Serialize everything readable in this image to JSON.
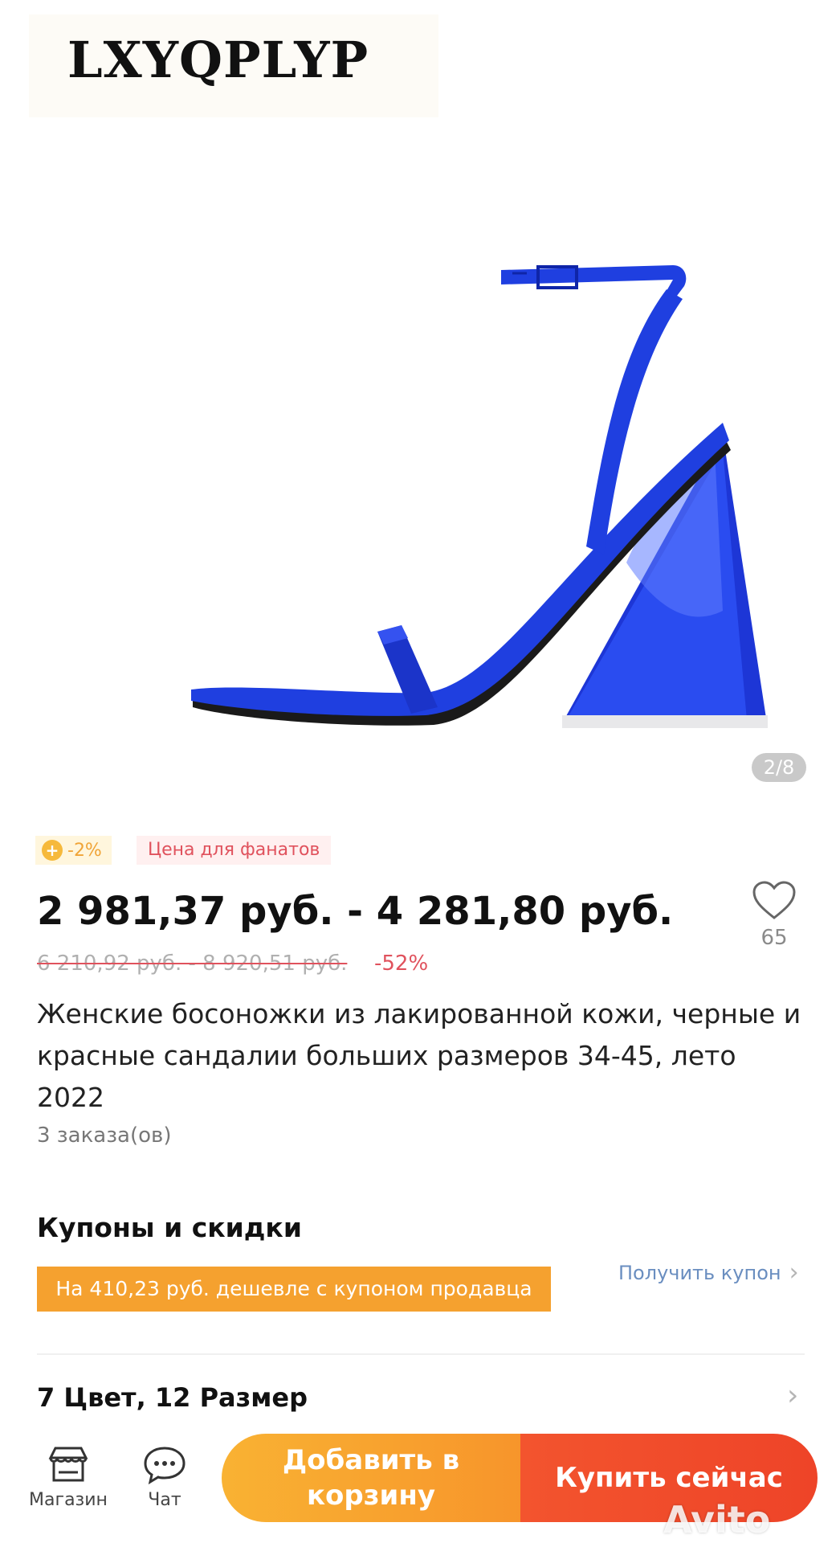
{
  "gallery": {
    "brand": "LXYQPLYP",
    "image_counter": "2/8",
    "colors": {
      "shoe": "#1f3fe0"
    }
  },
  "tags": {
    "coin": "-2%",
    "fan_price": "Цена для фанатов"
  },
  "price": {
    "current": "2 981,37 руб. - 4 281,80 руб.",
    "old": "6 210,92 руб. - 8 920,51 руб.",
    "discount": "-52%"
  },
  "wishlist": {
    "count": "65"
  },
  "product": {
    "title": "Женские босоножки из лакированной кожи, черные и красные сандалии больших размеров 34-45, лето 2022",
    "orders": "3 заказа(ов)"
  },
  "coupons": {
    "section_title": "Купоны и скидки",
    "banner": "На 410,23 руб. дешевле с купоном продавца",
    "get_coupon": "Получить купон"
  },
  "variants": {
    "label": "7 Цвет, 12 Размер"
  },
  "bottom_nav": {
    "store": "Магазин",
    "chat": "Чат",
    "add_to_cart": "Добавить в корзину",
    "buy_now": "Купить сейчас"
  },
  "watermark": "Avito"
}
